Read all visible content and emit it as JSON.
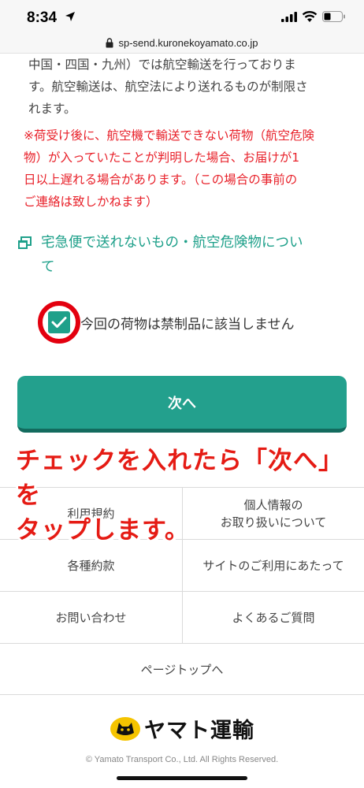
{
  "status_bar": {
    "time": "8:34"
  },
  "browser": {
    "url": "sp-send.kuronekoyamato.co.jp"
  },
  "content": {
    "notice_lines": [
      "中国・四国・九州）では航空輸送を行っておりま",
      "す。航空輸送は、航空法により送れるものが制限さ",
      "れます。"
    ],
    "warning_lines": [
      "※荷受け後に、航空機で輸送できない荷物（航空危険",
      "物）が入っていたことが判明した場合、お届けが1",
      "日以上遅れる場合があります。（この場合の事前の",
      "ご連絡は致しかねます）"
    ],
    "link_lines": [
      "宅急便で送れないもの・航空危険物につい",
      "て"
    ],
    "checkbox_label": "今回の荷物は禁制品に該当しません",
    "checkbox_checked": true,
    "next_button": "次へ"
  },
  "annotation": {
    "lines": [
      "チェックを入れたら「次へ」を",
      "タップします。"
    ]
  },
  "footer": {
    "rows": [
      [
        "利用規約",
        "個人情報の\nお取り扱いについて"
      ],
      [
        "各種約款",
        "サイトのご利用にあたって"
      ],
      [
        "お問い合わせ",
        "よくあるご質問"
      ]
    ],
    "page_top": "ページトップへ",
    "logo_text": "ヤマト運輸",
    "copyright": "© Yamato Transport Co., Ltd. All Rights Reserved."
  },
  "colors": {
    "accent": "#23a08d",
    "warning": "#e8212a",
    "annotation": "#e51b14"
  }
}
